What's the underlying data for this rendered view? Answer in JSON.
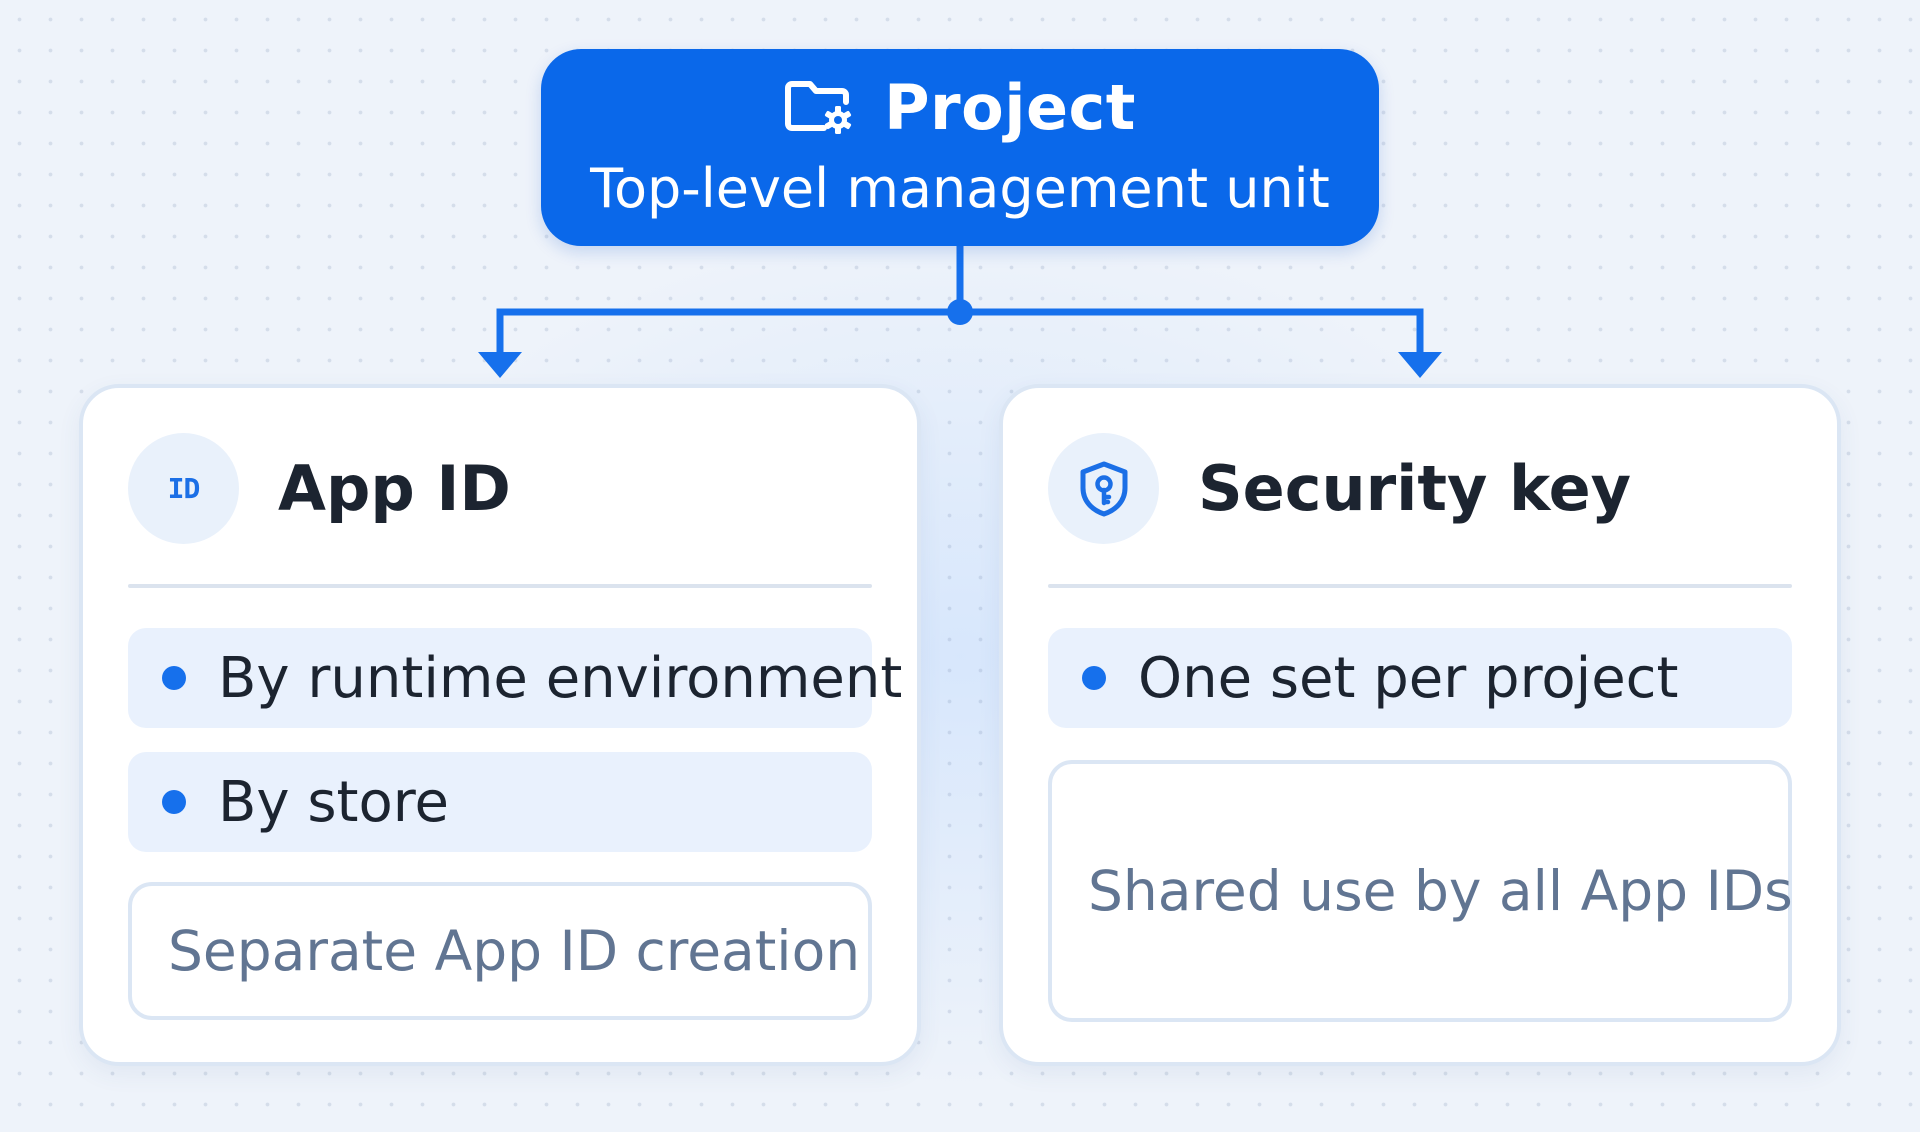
{
  "project": {
    "title": "Project",
    "subtitle": "Top-level management unit",
    "icon": "folder-settings-icon"
  },
  "cards": [
    {
      "title": "App ID",
      "icon": "id-badge-icon",
      "icon_text": "ID",
      "bullets": [
        "By runtime environment",
        "By store"
      ],
      "note": "Separate App ID creation"
    },
    {
      "title": "Security key",
      "icon": "shield-key-icon",
      "bullets": [
        "One set per project"
      ],
      "note": "Shared use by all App IDs"
    }
  ],
  "colors": {
    "accent": "#0a68ea",
    "connector": "#1670ec",
    "card_border": "#dbe6f4",
    "bullet_bg": "#e9f1fd",
    "note_text": "#617592",
    "title_text": "#1c2430"
  }
}
